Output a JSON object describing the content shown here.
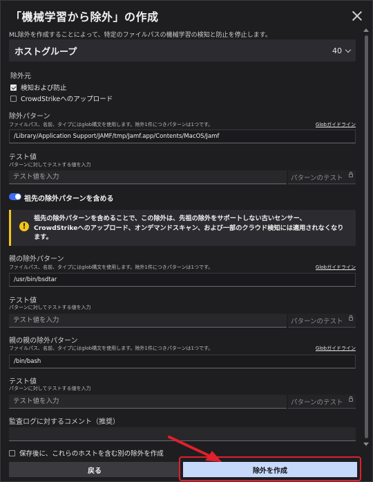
{
  "dialog": {
    "title": "「機械学習から除外」の作成",
    "subtitle": "ML除外を作成することによって、特定のファイルパスの機械学習の検知と防止を停止します。"
  },
  "host_group": {
    "label": "ホストグループ",
    "count": "40"
  },
  "exclude_from": {
    "heading": "除外元",
    "options": [
      {
        "label": "検知および防止",
        "checked": true
      },
      {
        "label": "CrowdStrikeへのアップロード",
        "checked": false
      }
    ]
  },
  "exclusion_pattern": {
    "label": "除外パターン",
    "help": "ファイルパス、名前、タイプにはglob構文を使用します。除外1件につきパターンは1つです。",
    "link": "Globガイドライン",
    "value": "/Library/Application Support/JAMF/tmp/Jamf.app/Contents/MacOS/Jamf"
  },
  "test1": {
    "label": "テスト値",
    "help": "パターンに対してテストする値を入力",
    "placeholder": "テスト値を入力",
    "button": "パターンのテスト"
  },
  "ancestor_toggle": {
    "label": "祖先の除外パターンを含める",
    "on": true
  },
  "warning": {
    "text": "祖先の除外パターンを含めることで、この除外は、先祖の除外をサポートしない古いセンサー、CrowdStrikeへのアップロード、オンデマンドスキャン、および一部のクラウド検知には適用されなくなります。"
  },
  "parent_pattern": {
    "label": "親の除外パターン",
    "help": "ファイルパス、名前、タイプにはglob構文を使用します。除外1件につきパターンは1つです。",
    "link": "Globガイドライン",
    "value": "/usr/bin/bsdtar"
  },
  "test2": {
    "label": "テスト値",
    "help": "パターンに対してテストする値を入力",
    "placeholder": "テスト値を入力",
    "button": "パターンのテスト"
  },
  "grandparent_pattern": {
    "label": "親の親の除外パターン",
    "help": "ファイルパス、名前、タイプにはglob構文を使用します。除外1件につきパターンは1つです。",
    "link": "Globガイドライン",
    "value": "/bin/bash"
  },
  "test3": {
    "label": "テスト値",
    "help": "パターンに対してテストする値を入力",
    "placeholder": "テスト値を入力",
    "button": "パターンのテスト"
  },
  "audit_comment": {
    "label": "監査ログに対するコメント（推奨）",
    "value": ""
  },
  "save_another": {
    "label": "保存後に、これらのホストを含む別の除外を作成",
    "checked": false
  },
  "footer": {
    "back": "戻る",
    "create": "除外を作成"
  },
  "colors": {
    "accent": "#3f6df2",
    "warning": "#f5c518",
    "primary_button": "#c6d9fb",
    "highlight": "#e0202a"
  }
}
